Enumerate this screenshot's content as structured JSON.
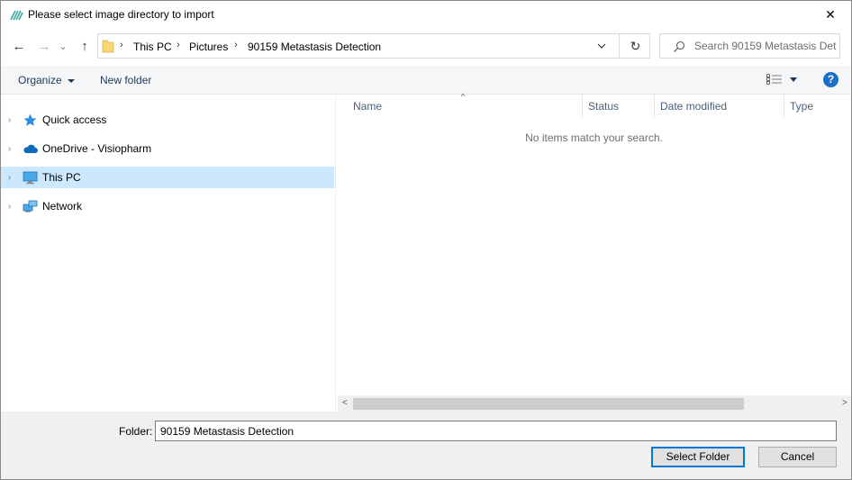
{
  "window": {
    "title": "Please select image directory to import",
    "close_glyph": "✕",
    "app_icon": "visiopharm-logo-icon"
  },
  "navigation": {
    "back_glyph": "←",
    "forward_glyph": "→",
    "recent_glyph": "⌄",
    "up_glyph": "↑",
    "breadcrumb": [
      "This PC",
      "Pictures",
      "90159 Metastasis Detection"
    ],
    "separator": "›",
    "refresh_glyph": "↻"
  },
  "search": {
    "placeholder": "Search 90159 Metastasis Det..."
  },
  "toolbar": {
    "organize_label": "Organize",
    "new_folder_label": "New folder",
    "help_glyph": "?"
  },
  "sidebar": {
    "items": [
      {
        "label": "Quick access",
        "icon": "star-icon",
        "selected": false
      },
      {
        "label": "OneDrive - Visiopharm",
        "icon": "cloud-icon",
        "selected": false
      },
      {
        "label": "This PC",
        "icon": "computer-icon",
        "selected": true
      },
      {
        "label": "Network",
        "icon": "network-icon",
        "selected": false
      }
    ],
    "chevron_glyph": "›"
  },
  "file_list": {
    "columns": [
      "Name",
      "Status",
      "Date modified",
      "Type"
    ],
    "sort_glyph": "^",
    "empty_message": "No items match your search."
  },
  "scrollbar": {
    "left_glyph": "<",
    "right_glyph": ">"
  },
  "footer": {
    "folder_label": "Folder:",
    "folder_value": "90159 Metastasis Detection",
    "select_button": "Select Folder",
    "cancel_button": "Cancel"
  },
  "colors": {
    "selected_bg": "#cce8ff",
    "accent": "#0078d7",
    "help_blue": "#1c6fc9",
    "folder_yellow": "#f8d775"
  }
}
